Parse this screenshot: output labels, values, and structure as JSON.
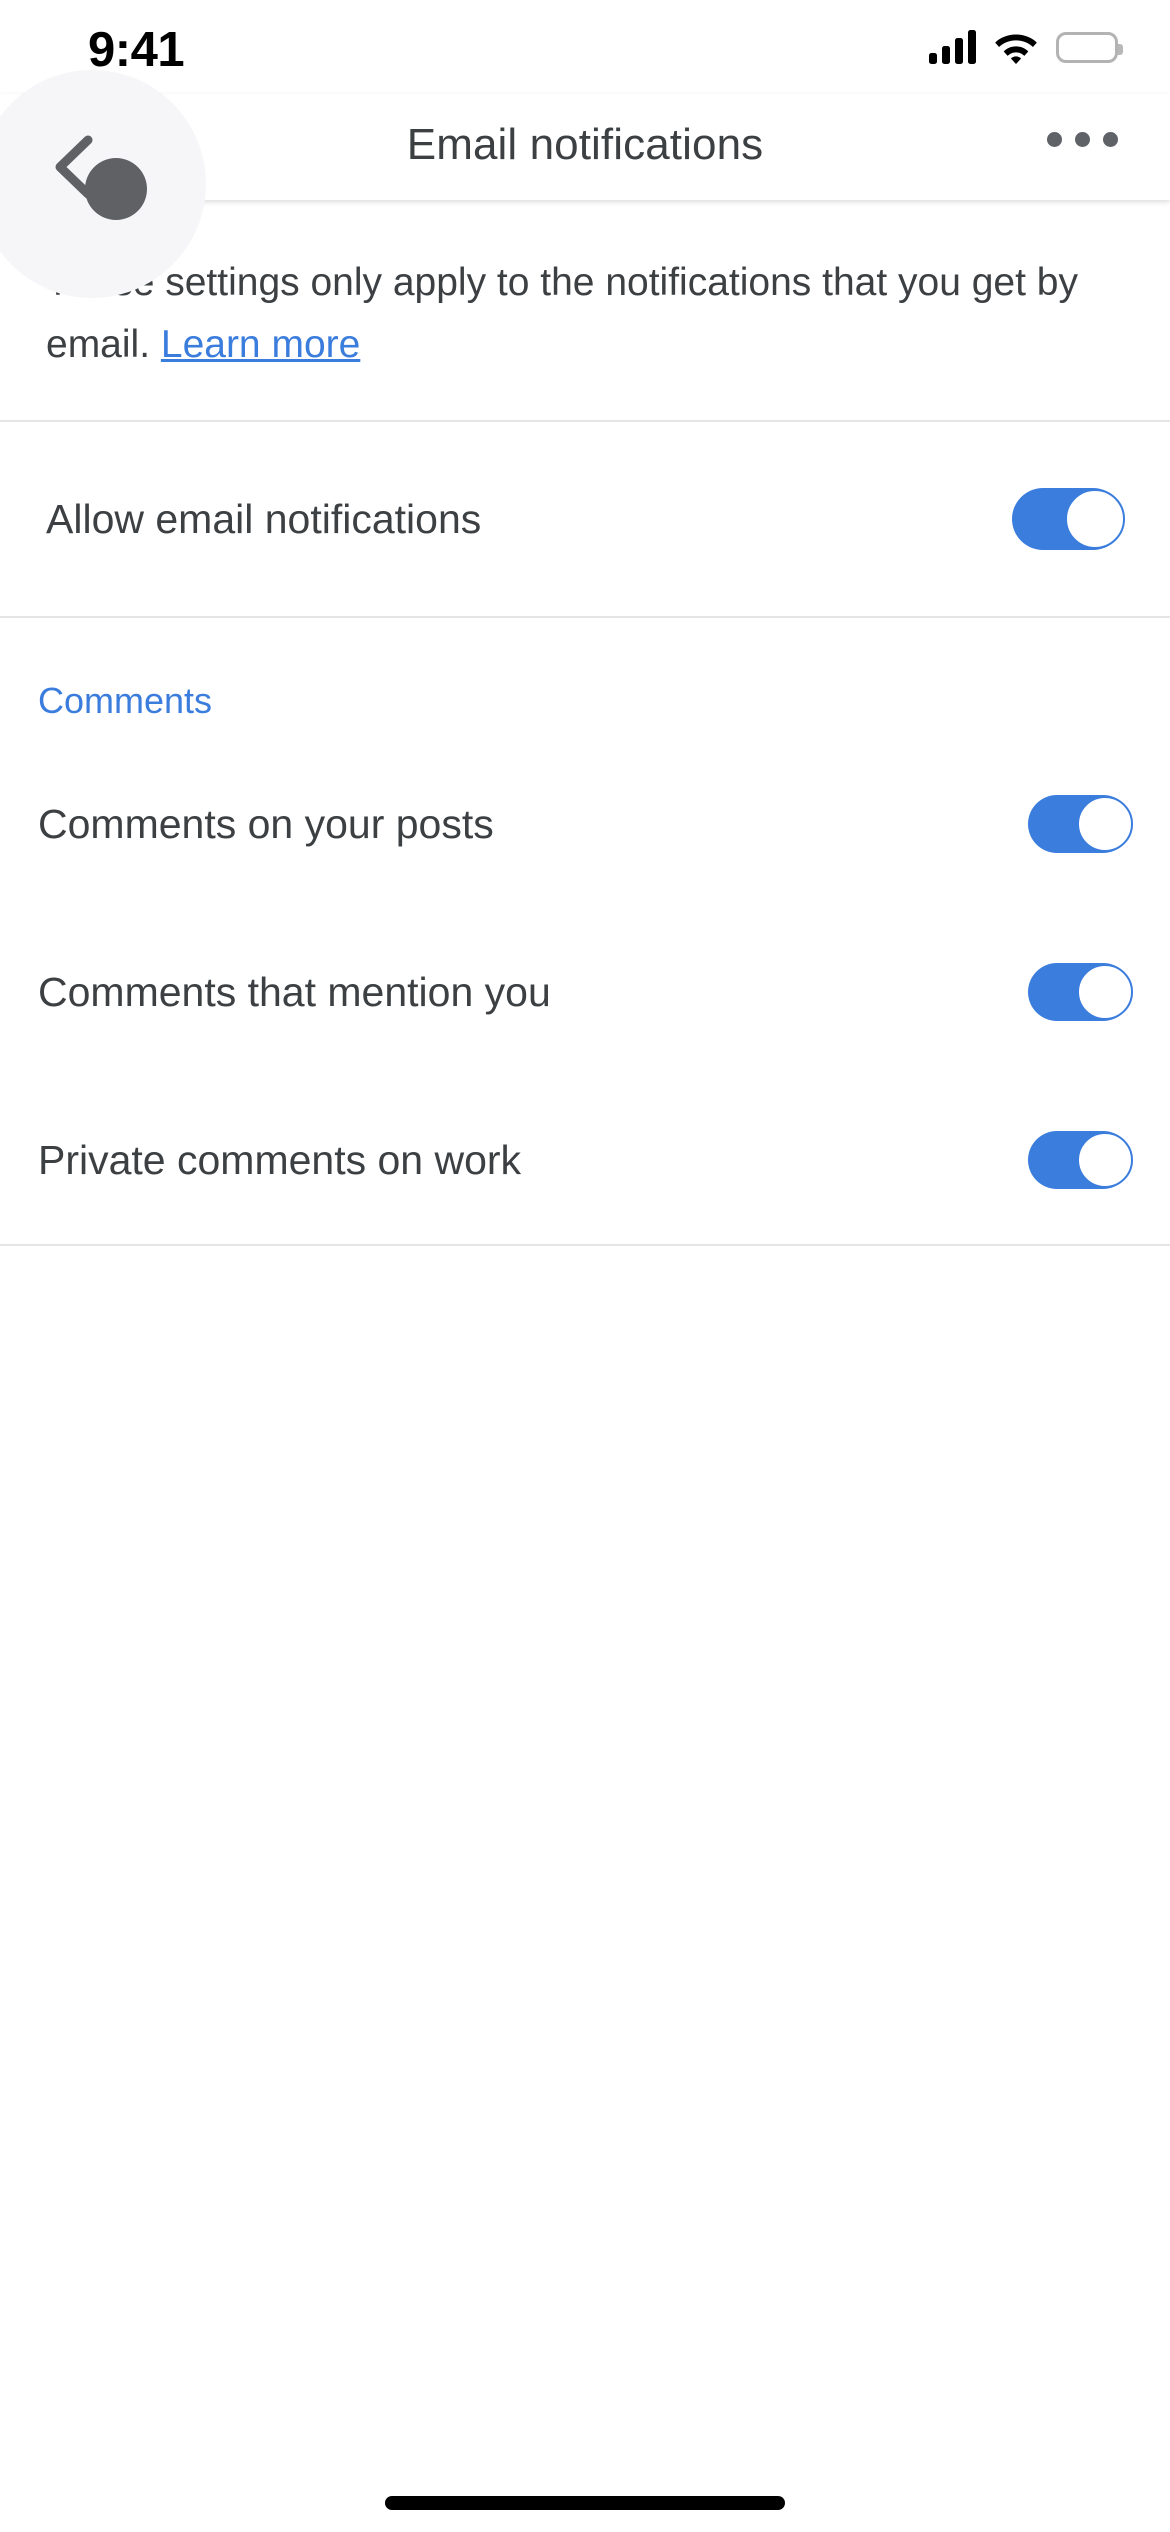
{
  "status_bar": {
    "time": "9:41",
    "cellular_icon": "signal-bars-icon",
    "wifi_icon": "wifi-icon",
    "battery_icon": "battery-full-icon"
  },
  "app_bar": {
    "back_icon": "back-chevron-icon",
    "title": "Email notifications",
    "overflow_icon": "overflow-menu-icon",
    "cursor_icon": "cursor-pointer-icon"
  },
  "description": {
    "text": "These settings only apply to the notifications that you get by email. ",
    "link_label": "Learn more"
  },
  "master_toggle": {
    "label": "Allow email notifications",
    "state": "on"
  },
  "sections": [
    {
      "header": "Comments",
      "items": [
        {
          "label": "Comments on your posts",
          "state": "on"
        },
        {
          "label": "Comments that mention you",
          "state": "on"
        },
        {
          "label": "Private comments on work",
          "state": "on"
        }
      ]
    }
  ],
  "colors": {
    "accent_blue": "#3b7ddd",
    "text_primary": "#3c4043",
    "divider": "#e4e5e7",
    "cursor_gray": "#5f6165",
    "back_button_bg": "#f6f6f8"
  },
  "home_indicator": "home-indicator"
}
